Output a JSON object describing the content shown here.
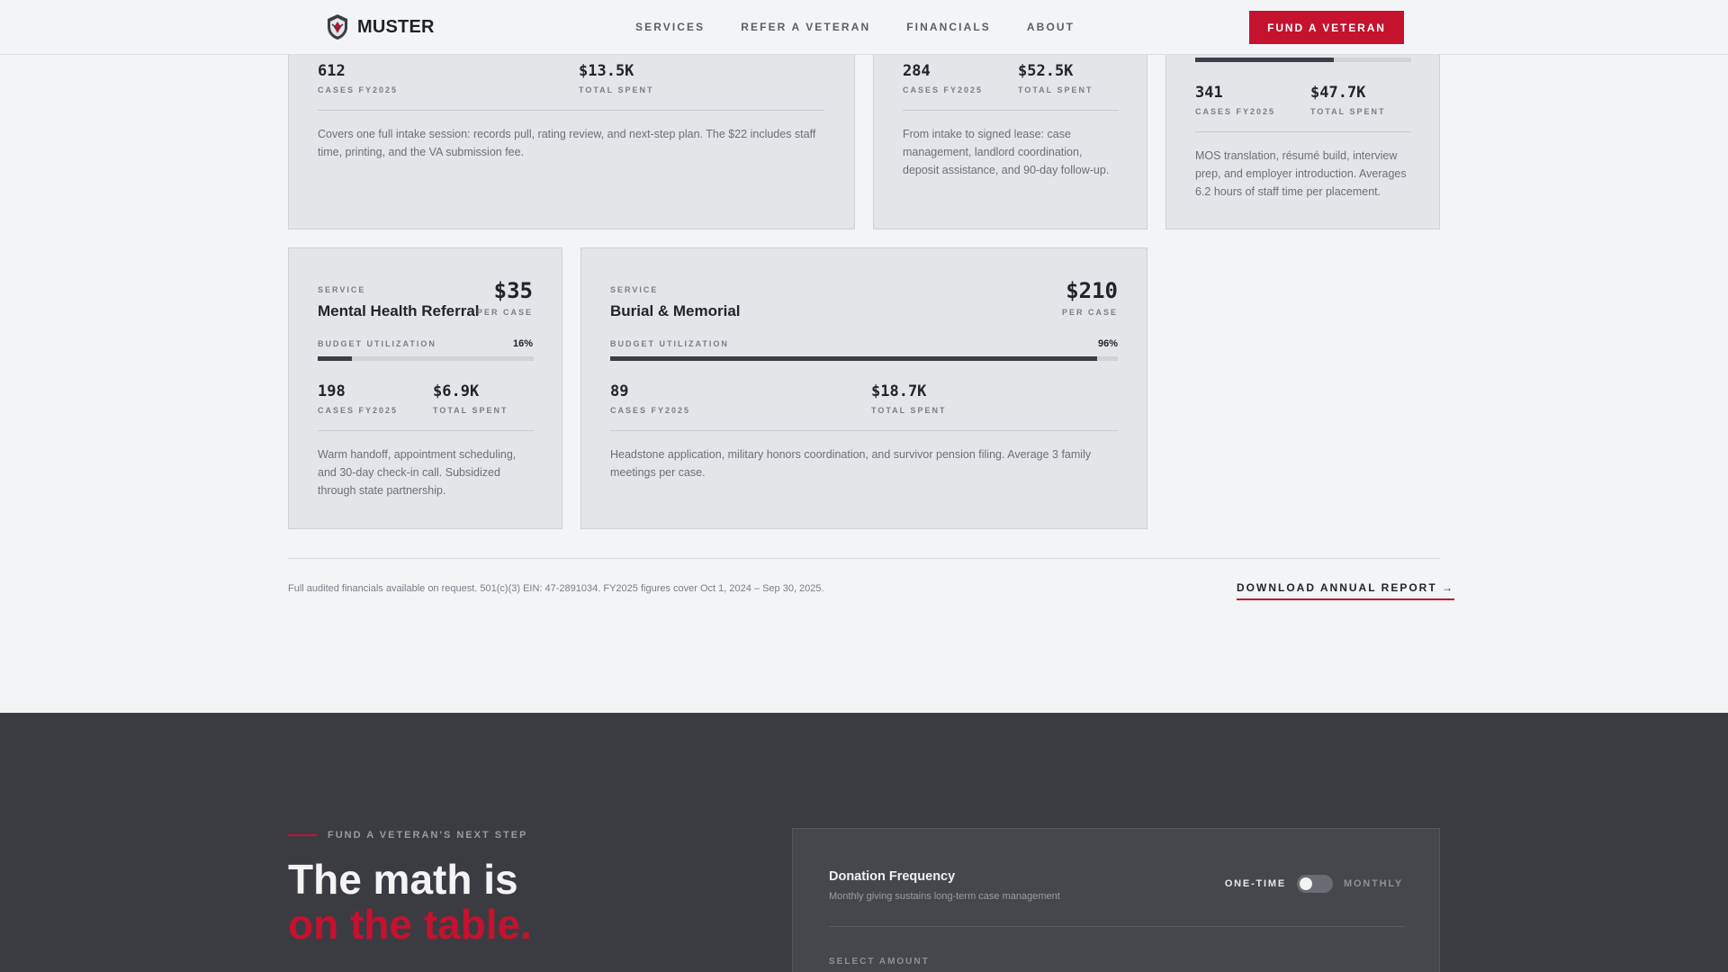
{
  "header": {
    "logo_text": "MUSTER",
    "nav": [
      "SERVICES",
      "REFER A VETERAN",
      "FINANCIALS",
      "ABOUT"
    ],
    "cta": "FUND A VETERAN"
  },
  "top_cards": [
    {
      "cases": "612",
      "cases_label": "CASES FY2025",
      "spent": "$13.5K",
      "spent_label": "TOTAL SPENT",
      "description": "Covers one full intake session: records pull, rating review, and next-step plan. The $22 includes staff time, printing, and the VA submission fee."
    },
    {
      "cases": "284",
      "cases_label": "CASES FY2025",
      "spent": "$52.5K",
      "spent_label": "TOTAL SPENT",
      "description": "From intake to signed lease: case management, landlord coordination, deposit assistance, and 90-day follow-up."
    },
    {
      "utilization": 0.64,
      "cases": "341",
      "cases_label": "CASES FY2025",
      "spent": "$47.7K",
      "spent_label": "TOTAL SPENT",
      "description": "MOS translation, résumé build, interview prep, and employer introduction. Averages 6.2 hours of staff time per placement."
    }
  ],
  "cards": [
    {
      "kicker": "SERVICE",
      "name": "Mental Health Referral",
      "price": "$35",
      "price_unit": "PER CASE",
      "util_label": "BUDGET UTILIZATION",
      "util_pct": "16%",
      "utilization": 0.16,
      "cases": "198",
      "cases_label": "CASES FY2025",
      "spent": "$6.9K",
      "spent_label": "TOTAL SPENT",
      "description": "Warm handoff, appointment scheduling, and 30-day check-in call. Subsidized through state partnership."
    },
    {
      "kicker": "SERVICE",
      "name": "Burial & Memorial",
      "price": "$210",
      "price_unit": "PER CASE",
      "util_label": "BUDGET UTILIZATION",
      "util_pct": "96%",
      "utilization": 0.96,
      "cases": "89",
      "cases_label": "CASES FY2025",
      "spent": "$18.7K",
      "spent_label": "TOTAL SPENT",
      "description": "Headstone application, military honors coordination, and survivor pension filing. Average 3 family meetings per case."
    }
  ],
  "footnote": "Full audited financials available on request. 501(c)(3) EIN: 47-2891034. FY2025 figures cover Oct 1, 2024 – Sep 30, 2025.",
  "download_link": "DOWNLOAD ANNUAL REPORT →",
  "fund": {
    "eyebrow": "FUND A VETERAN'S NEXT STEP",
    "headline_1": "The math is",
    "headline_2": "on the table.",
    "panel_title": "Donation Frequency",
    "panel_sub": "Monthly giving sustains long-term case management",
    "toggle_on": "ONE-TIME",
    "toggle_off": "MONTHLY",
    "select_label": "SELECT AMOUNT"
  },
  "colors": {
    "accent": "#c4122f",
    "dark_bg": "#3a3c42",
    "card_bg": "#e4e5e8"
  }
}
